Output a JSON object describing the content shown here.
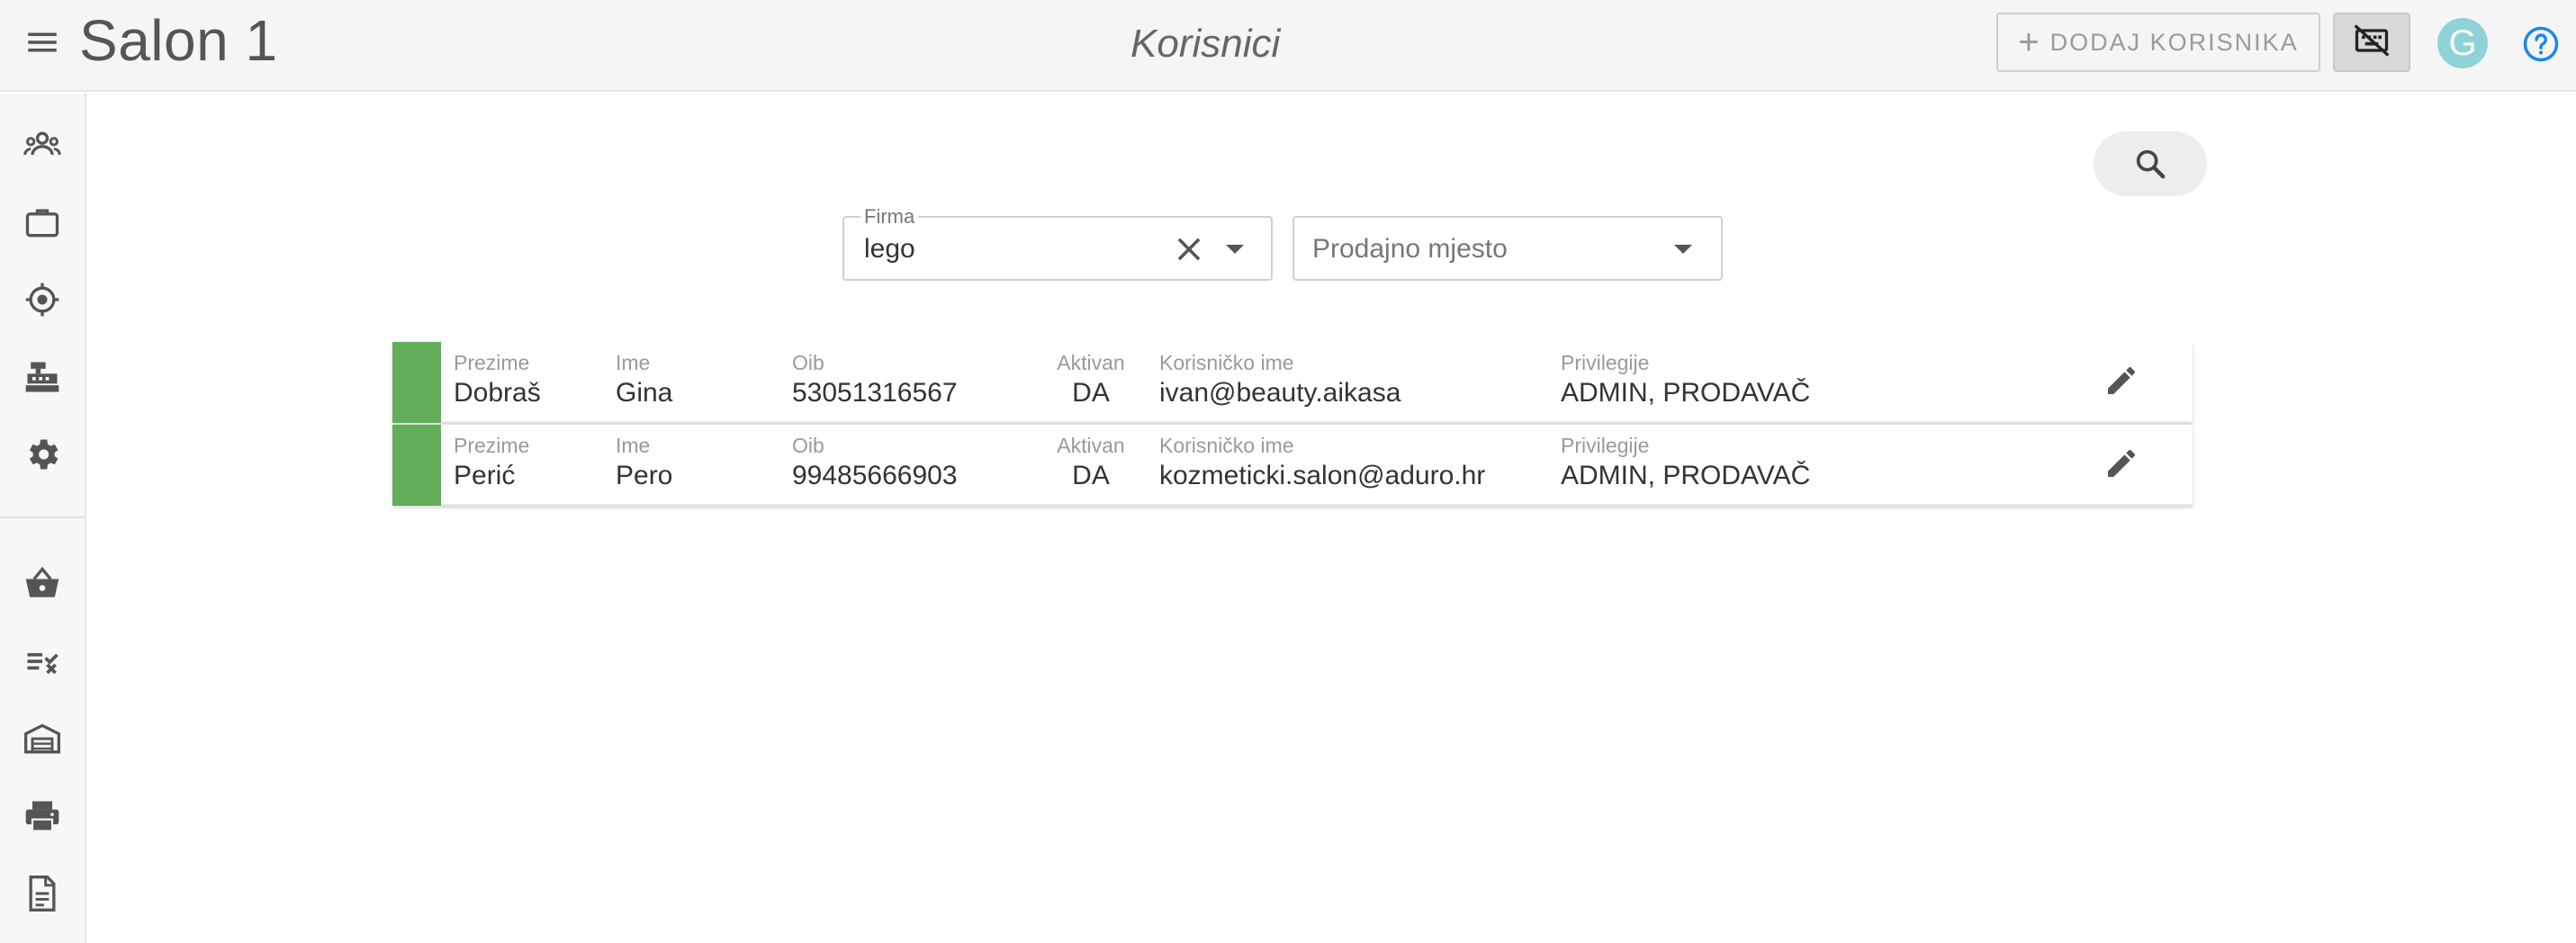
{
  "app": {
    "title": "Salon 1",
    "page_title": "Korisnici"
  },
  "toolbar": {
    "add_user_label": "DODAJ KORISNIKA",
    "avatar_letter": "G"
  },
  "sidebar": {
    "items": [
      {
        "icon": "users-icon"
      },
      {
        "icon": "briefcase-icon"
      },
      {
        "icon": "location-icon"
      },
      {
        "icon": "cash-register-icon"
      },
      {
        "icon": "settings-icon"
      },
      {
        "icon": "basket-icon"
      },
      {
        "icon": "checklist-icon"
      },
      {
        "icon": "warehouse-icon"
      },
      {
        "icon": "printer-icon"
      },
      {
        "icon": "document-icon"
      }
    ]
  },
  "filters": {
    "firma": {
      "label": "Firma",
      "value": "lego"
    },
    "prodajno_mjesto": {
      "placeholder": "Prodajno mjesto"
    }
  },
  "table": {
    "headers": {
      "prezime": "Prezime",
      "ime": "Ime",
      "oib": "Oib",
      "aktivan": "Aktivan",
      "korisnicko_ime": "Korisničko ime",
      "privilegije": "Privilegije"
    },
    "rows": [
      {
        "prezime": "Dobraš",
        "ime": "Gina",
        "oib": "53051316567",
        "aktivan": "DA",
        "korisnicko_ime": "ivan@beauty.aikasa",
        "privilegije": "ADMIN, PRODAVAČ"
      },
      {
        "prezime": "Perić",
        "ime": "Pero",
        "oib": "99485666903",
        "aktivan": "DA",
        "korisnicko_ime": "kozmeticki.salon@aduro.hr",
        "privilegije": "ADMIN, PRODAVAČ"
      }
    ]
  },
  "colors": {
    "status_active": "#62ae5a",
    "avatar_bg": "#8fd3d8",
    "help_blue": "#1e88e5"
  }
}
